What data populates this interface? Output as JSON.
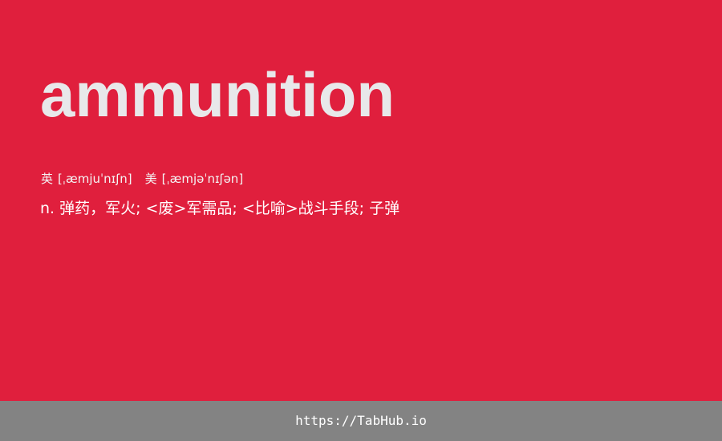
{
  "entry": {
    "word": "ammunition",
    "phonetics": {
      "uk_label": "英",
      "uk_ipa": "[ˌæmjuˈnɪʃn]",
      "us_label": "美",
      "us_ipa": "[ˌæmjəˈnɪʃən]"
    },
    "definition": "n. 弹药，军火; <废>军需品; <比喻>战斗手段; 子弹"
  },
  "footer": {
    "link_text": "https://TabHub.io"
  },
  "colors": {
    "card_background": "#e01f3d",
    "word_color": "#e8e8ea",
    "footer_background": "#838383"
  }
}
